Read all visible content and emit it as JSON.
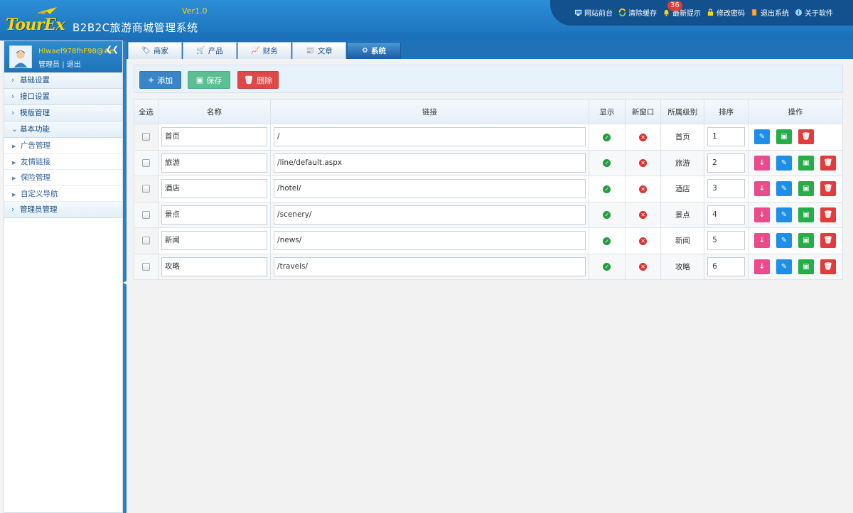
{
  "app": {
    "version": "Ver1.0",
    "logo_text": "TourEx",
    "title": "B2B2C旅游商城管理系统"
  },
  "topnav": {
    "items": [
      {
        "label": "网站前台",
        "icon": "monitor-icon"
      },
      {
        "label": "清除缓存",
        "icon": "refresh-icon"
      },
      {
        "label": "最新提示",
        "icon": "bell-icon",
        "badge": "36"
      },
      {
        "label": "修改密码",
        "icon": "lock-icon"
      },
      {
        "label": "退出系统",
        "icon": "exit-icon"
      },
      {
        "label": "关于软件",
        "icon": "info-icon"
      }
    ]
  },
  "user": {
    "name": "Hlwaef978fhF98@#e",
    "role": "管理员",
    "logout": "退出",
    "separator": "|"
  },
  "sidebar": {
    "items": [
      {
        "label": "基础设置",
        "type": "group",
        "expanded": false
      },
      {
        "label": "接口设置",
        "type": "group",
        "expanded": false
      },
      {
        "label": "模版管理",
        "type": "group",
        "expanded": false
      },
      {
        "label": "基本功能",
        "type": "group",
        "expanded": true
      },
      {
        "label": "广告管理",
        "type": "sub"
      },
      {
        "label": "友情链接",
        "type": "sub"
      },
      {
        "label": "保险管理",
        "type": "sub"
      },
      {
        "label": "自定义导航",
        "type": "sub"
      },
      {
        "label": "管理员管理",
        "type": "group",
        "expanded": false
      }
    ]
  },
  "tabs": [
    {
      "label": "商家",
      "icon": "tag-icon"
    },
    {
      "label": "产品",
      "icon": "cart-icon"
    },
    {
      "label": "财务",
      "icon": "chart-icon"
    },
    {
      "label": "文章",
      "icon": "newspaper-icon"
    },
    {
      "label": "系统",
      "icon": "gear-icon",
      "active": true
    }
  ],
  "toolbar": {
    "add_label": "添加",
    "save_label": "保存",
    "delete_label": "删除"
  },
  "table": {
    "headers": [
      "全选",
      "名称",
      "链接",
      "显示",
      "新窗口",
      "所属级别",
      "排序",
      "操作"
    ],
    "rows": [
      {
        "name": "首页",
        "link": "/",
        "show": true,
        "new_window": false,
        "level": "首页",
        "sort": "1",
        "movable": false
      },
      {
        "name": "旅游",
        "link": "/line/default.aspx",
        "show": true,
        "new_window": false,
        "level": "旅游",
        "sort": "2",
        "movable": true
      },
      {
        "name": "酒店",
        "link": "/hotel/",
        "show": true,
        "new_window": false,
        "level": "酒店",
        "sort": "3",
        "movable": true
      },
      {
        "name": "景点",
        "link": "/scenery/",
        "show": true,
        "new_window": false,
        "level": "景点",
        "sort": "4",
        "movable": true
      },
      {
        "name": "新闻",
        "link": "/news/",
        "show": true,
        "new_window": false,
        "level": "新闻",
        "sort": "5",
        "movable": true
      },
      {
        "name": "攻略",
        "link": "/travels/",
        "show": true,
        "new_window": false,
        "level": "攻略",
        "sort": "6",
        "movable": true
      }
    ]
  },
  "colors": {
    "header": "#1a6fb8",
    "accent": "#ffd500",
    "add": "#3a85c8",
    "save": "#5bbf94",
    "delete": "#e04848"
  }
}
